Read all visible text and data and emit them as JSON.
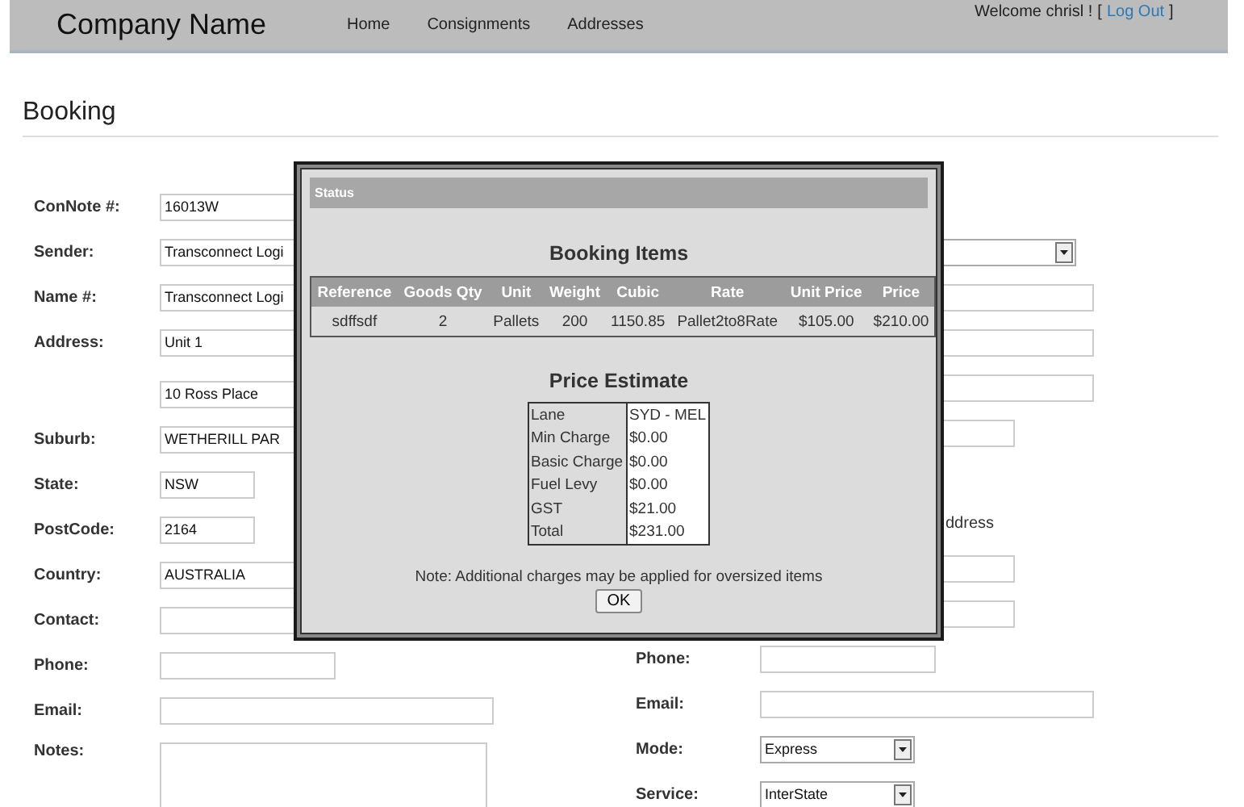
{
  "header": {
    "company": "Company Name",
    "nav": [
      {
        "label": "Home"
      },
      {
        "label": "Consignments"
      },
      {
        "label": "Addresses"
      }
    ],
    "welcome": "Welcome chrisl !",
    "bracket_open": "[",
    "logout": "Log Out",
    "bracket_close": "]"
  },
  "page_title": "Booking",
  "left_fields": [
    {
      "kind": "wide",
      "label": "ConNote #:",
      "value": "16013W"
    },
    {
      "kind": "wide",
      "label": "Sender:",
      "value": "Transconnect Logi"
    },
    {
      "kind": "wide",
      "label": "Name #:",
      "value": "Transconnect Logi"
    },
    {
      "kind": "wide",
      "label": "Address:",
      "value": "Unit 1"
    },
    {
      "kind": "wide",
      "value": "10 Ross Place"
    },
    {
      "kind": "wide",
      "label": "Suburb:",
      "value": "WETHERILL PAR"
    },
    {
      "kind": "short",
      "label": "State:",
      "value": "NSW"
    },
    {
      "kind": "short",
      "label": "PostCode:",
      "value": "2164"
    },
    {
      "kind": "wide",
      "label": "Country:",
      "value": "AUSTRALIA"
    },
    {
      "kind": "wide",
      "label": "Contact:"
    },
    {
      "kind": "medium",
      "label": "Phone:"
    },
    {
      "kind": "wide",
      "label": "Email:"
    },
    {
      "kind": "textarea",
      "label": "Notes:"
    }
  ],
  "right_fields": [
    {
      "kind": "blank"
    },
    {
      "kind": "select"
    },
    {
      "kind": "wide"
    },
    {
      "kind": "wide"
    },
    {
      "kind": "wide"
    },
    {
      "kind": "narrow"
    },
    {
      "kind": "blank"
    },
    {
      "kind": "note",
      "text": "ddress"
    },
    {
      "kind": "narrow"
    },
    {
      "kind": "narrow"
    },
    {
      "kind": "medium",
      "label": "Phone:"
    },
    {
      "kind": "wide",
      "label": "Email:"
    },
    {
      "kind": "select",
      "label": "Mode:",
      "value": "Express"
    },
    {
      "kind": "select",
      "label": "Service:",
      "value": "InterState"
    }
  ],
  "dialog": {
    "title": "Status",
    "items_heading": "Booking Items",
    "items_columns": [
      "Reference",
      "Goods Qty",
      "Unit",
      "Weight",
      "Cubic",
      "Rate",
      "Unit Price",
      "Price"
    ],
    "items_rows": [
      [
        "sdffsdf",
        "2",
        "Pallets",
        "200",
        "1150.85",
        "Pallet2to8Rate",
        "$105.00",
        "$210.00"
      ]
    ],
    "estimate_heading": "Price Estimate",
    "estimate_rows": [
      {
        "label": "Lane",
        "value": "SYD - MEL"
      },
      {
        "label": "Min Charge",
        "value": "$0.00"
      },
      {
        "label": "Basic Charge",
        "value": "$0.00"
      },
      {
        "label": "Fuel Levy",
        "value": "$0.00"
      },
      {
        "label": "GST",
        "value": "$21.00"
      },
      {
        "label": "Total",
        "value": "$231.00"
      }
    ],
    "note": "Note: Additional charges may be applied for oversized items",
    "ok": "OK"
  }
}
